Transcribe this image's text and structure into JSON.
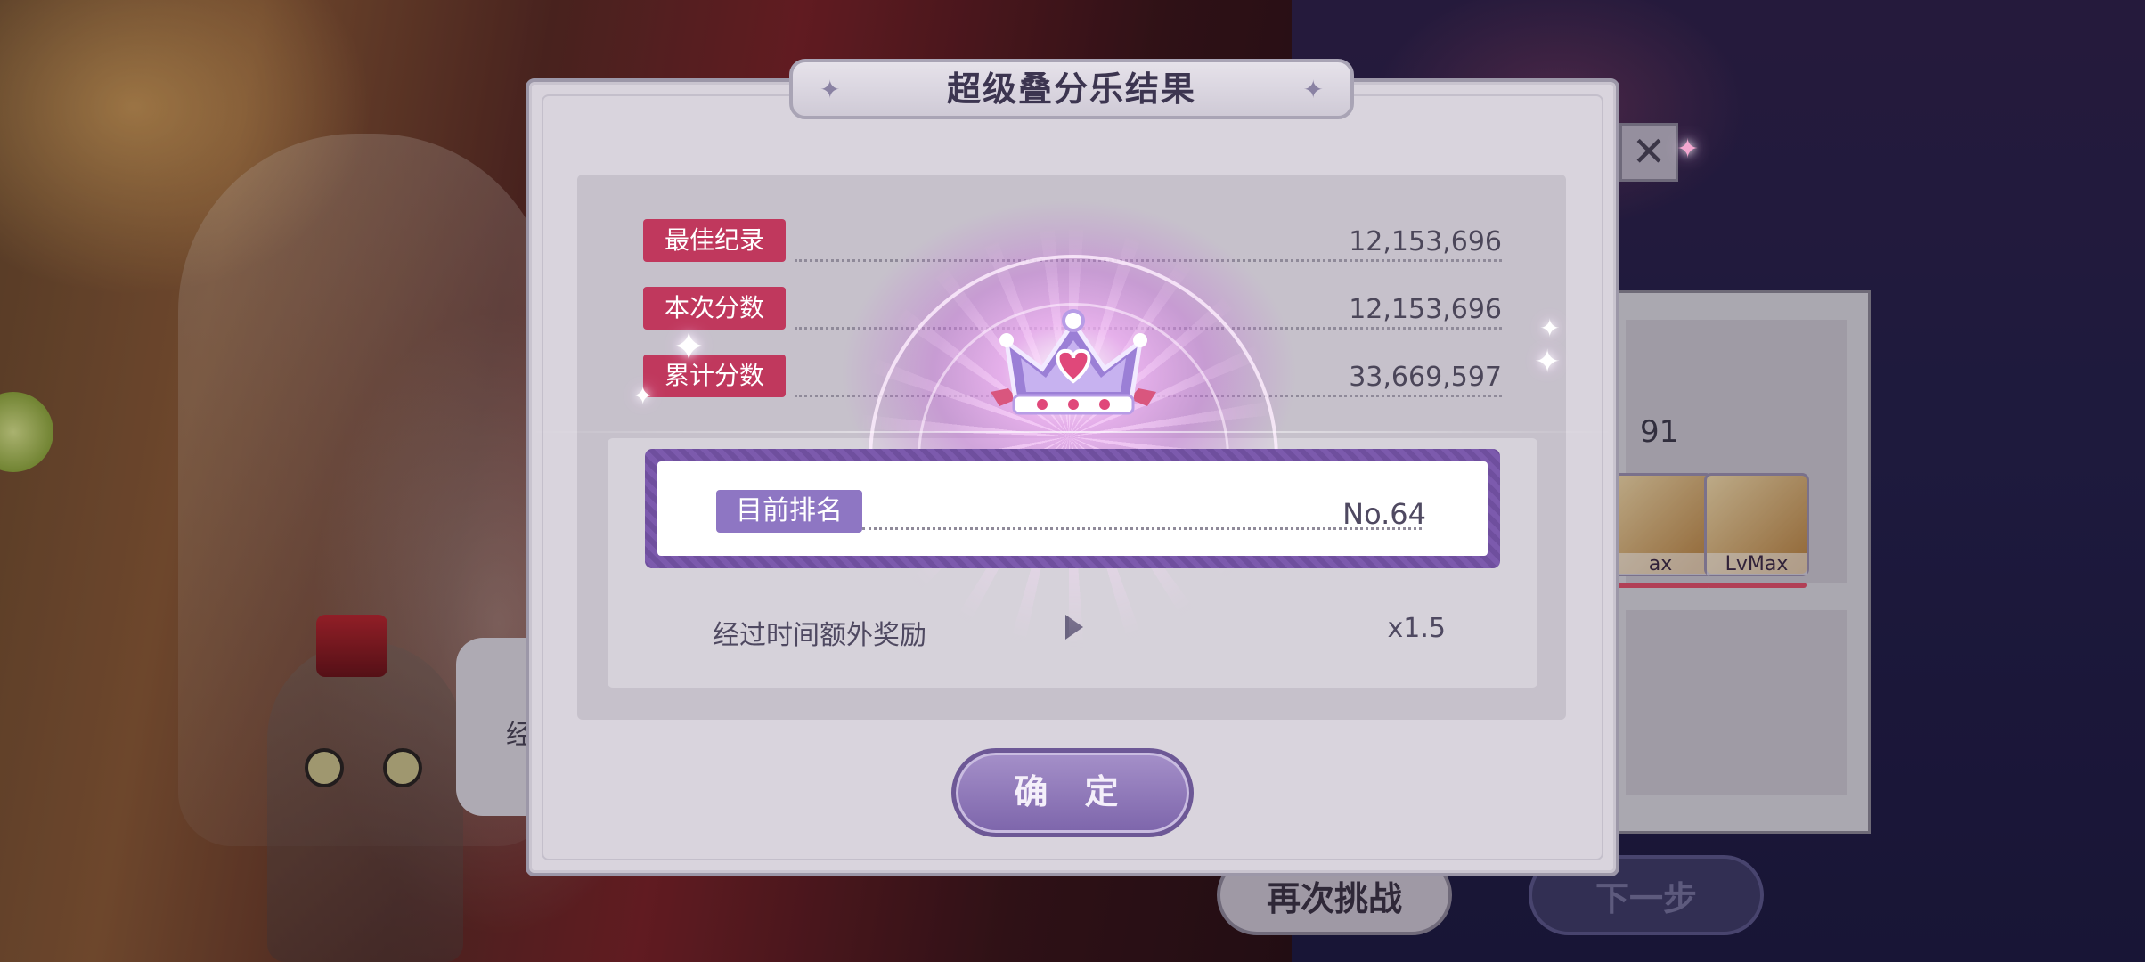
{
  "dialog": {
    "title": "超级叠分乐结果",
    "stats": [
      {
        "label": "最佳纪录",
        "value": "12,153,696"
      },
      {
        "label": "本次分数",
        "value": "12,153,696"
      },
      {
        "label": "累计分数",
        "value": "33,669,597"
      }
    ],
    "rank": {
      "label": "目前排名",
      "value": "No.64"
    },
    "bonus": {
      "label": "经过时间额外奖励",
      "value": "x1.5"
    },
    "confirm_label": "确 定"
  },
  "background": {
    "retry_label": "再次挑战",
    "next_label": "下一步",
    "score_partial": "91",
    "card_label_1": "ax",
    "card_label_2": "LvMax",
    "side_text": "经",
    "close_glyph": "✕"
  },
  "colors": {
    "stat_badge": "#c0385d",
    "rank_badge": "#8e76c3",
    "confirm": "#8d76b8"
  },
  "icons": [
    "crown-icon",
    "star-icon",
    "close-icon",
    "play-arrow-icon"
  ]
}
